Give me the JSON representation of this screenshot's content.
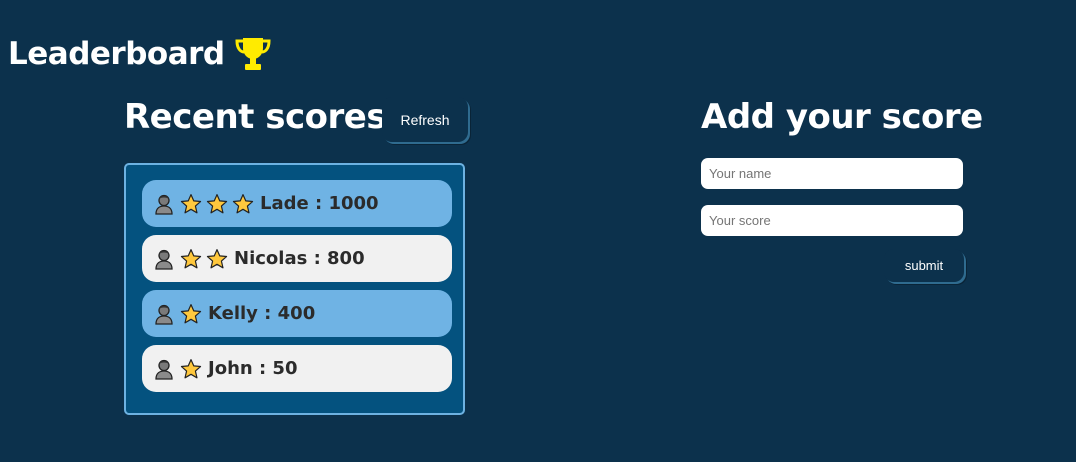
{
  "header": {
    "title": "Leaderboard",
    "trophy_icon": "trophy-icon",
    "trophy_color": "#ffeb00"
  },
  "recent": {
    "title": "Recent scores",
    "refresh_label": "Refresh",
    "scores": [
      {
        "text": "Lade : 1000",
        "stars": 3,
        "style": "blue"
      },
      {
        "text": "Nicolas : 800",
        "stars": 2,
        "style": "gray"
      },
      {
        "text": "Kelly : 400",
        "stars": 1,
        "style": "blue"
      },
      {
        "text": "John : 50",
        "stars": 1,
        "style": "gray"
      }
    ]
  },
  "form": {
    "title": "Add your score",
    "name_placeholder": "Your name",
    "name_value": "",
    "score_placeholder": "Your score",
    "score_value": "",
    "submit_label": "submit"
  },
  "colors": {
    "background": "#0c314c",
    "scores_box": "#04527f",
    "row_blue": "#6fb3e4",
    "row_gray": "#f1f1f1",
    "star": "#ffc83d"
  }
}
